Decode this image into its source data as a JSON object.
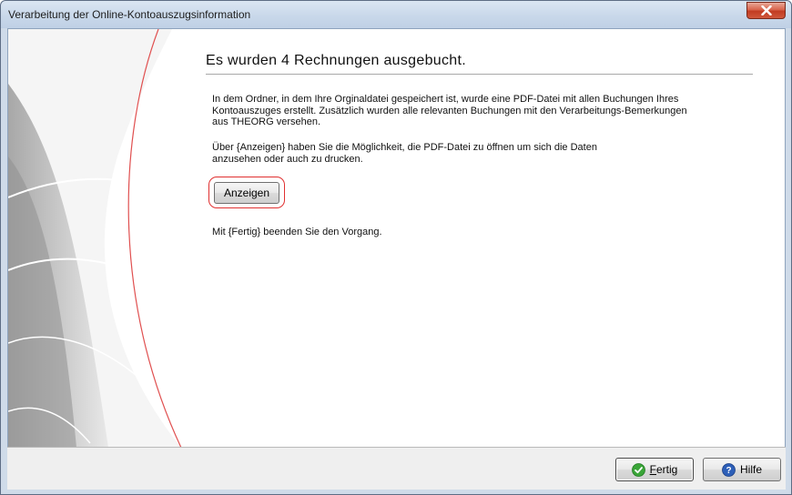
{
  "window": {
    "title": "Verarbeitung der Online-Kontoauszugsinformation"
  },
  "content": {
    "heading": "Es wurden 4 Rechnungen ausgebucht.",
    "paragraph_1": "In dem Ordner, in dem Ihre Orginaldatei gespeichert ist, wurde eine PDF-Datei mit allen Buchungen Ihres Kontoauszuges erstellt. Zusätzlich wurden alle relevanten Buchungen mit den Verarbeitungs-Bemerkungen aus THEORG versehen.",
    "paragraph_2": "Über {Anzeigen} haben Sie die Möglichkeit, die PDF-Datei zu öffnen um sich die Daten anzusehen oder auch zu drucken.",
    "anzeigen_label": "Anzeigen",
    "paragraph_3": "Mit {Fertig} beenden Sie den Vorgang."
  },
  "footer": {
    "fertig_first": "F",
    "fertig_rest": "ertig",
    "hilfe_label": "Hilfe"
  },
  "icons": {
    "close": "close-icon",
    "fertig": "check-circle-icon",
    "hilfe": "help-circle-icon"
  },
  "colors": {
    "highlight_ring": "#e03030",
    "fertig_icon": "#3aa538",
    "hilfe_icon": "#2d5fb8",
    "close_button": "#c9452b"
  }
}
